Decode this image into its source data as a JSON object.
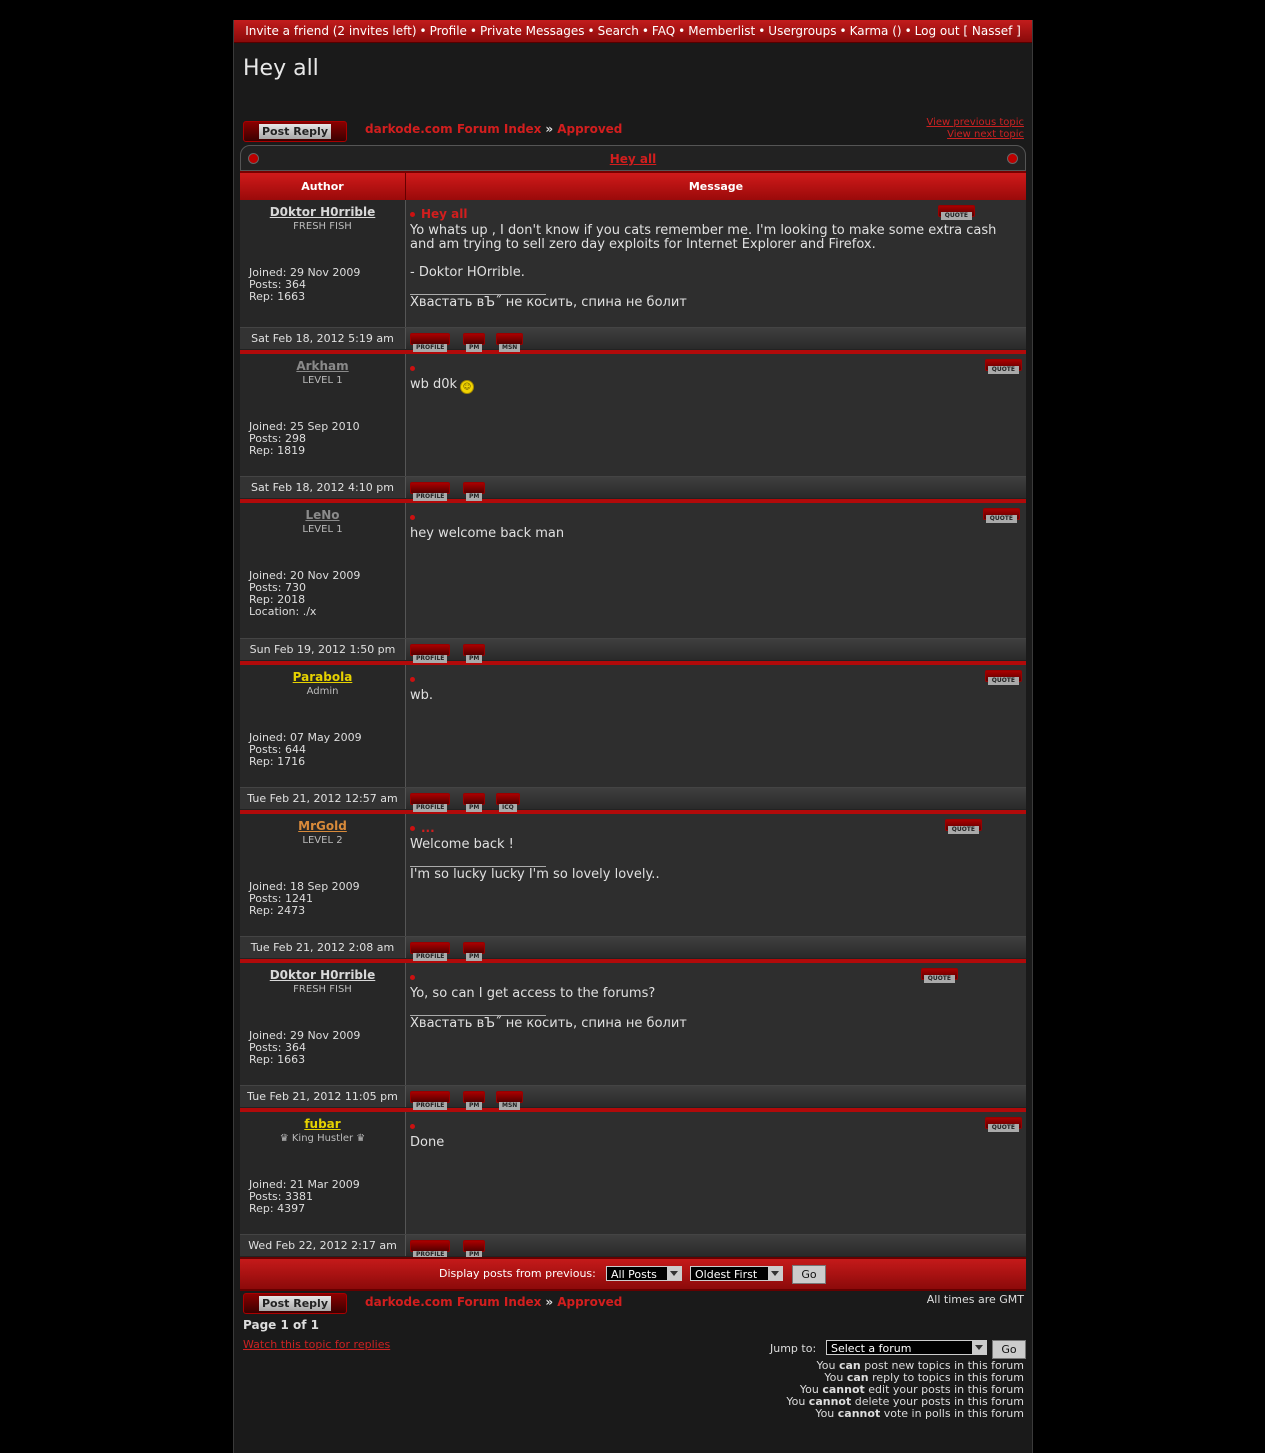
{
  "topnav": {
    "invite": "Invite a friend (2 invites left)",
    "profile": "Profile",
    "pm": "Private Messages",
    "search": "Search",
    "faq": "FAQ",
    "memberlist": "Memberlist",
    "usergroups": "Usergroups",
    "karma": "Karma ()",
    "logout": "Log out [ Nassef ]"
  },
  "topic_title": "Hey all",
  "post_reply_label": "Post Reply",
  "breadcrumb": {
    "index": "darkode.com Forum Index",
    "arrow": "»",
    "forum": "Approved"
  },
  "topic_nav": {
    "prev": "View previous topic",
    "next": "View next topic"
  },
  "table": {
    "caption": "Hey all",
    "col_author": "Author",
    "col_message": "Message"
  },
  "buttons": {
    "quote": "QUOTE",
    "profile": "PROFILE",
    "pm": "PM",
    "msn": "MSN",
    "icq": "ICQ"
  },
  "posts": [
    {
      "author": "D0ktor H0rrible",
      "author_color": "#d8d8d8",
      "rank": "FRESH FISH",
      "joined": "Joined: 29 Nov 2009",
      "posts": "Posts: 364",
      "rep": "Rep: 1663",
      "location": "",
      "subject": "Hey all",
      "body": "Yo whats up , I don't know if you cats remember me. I'm looking to make some extra cash and am trying to sell zero day exploits for Internet Explorer and Firefox.",
      "body2": "- Doktor HOrrible.",
      "sig": "Хваcтать вЪ˝ не косить, спина не болит",
      "date": "Sat Feb 18, 2012 5:19 am"
    },
    {
      "author": "Arkham",
      "author_color": "#8a8a8a",
      "rank": "LEVEL 1",
      "joined": "Joined: 25 Sep 2010",
      "posts": "Posts: 298",
      "rep": "Rep: 1819",
      "location": "",
      "subject": "",
      "body": "wb d0k",
      "body2": "",
      "sig": "",
      "date": "Sat Feb 18, 2012 4:10 pm"
    },
    {
      "author": "LeNo",
      "author_color": "#8a8a8a",
      "rank": "LEVEL 1",
      "joined": "Joined: 20 Nov 2009",
      "posts": "Posts: 730",
      "rep": "Rep: 2018",
      "location": "Location: ./x",
      "subject": "",
      "body": "hey welcome back man",
      "body2": "",
      "sig": "",
      "date": "Sun Feb 19, 2012 1:50 pm"
    },
    {
      "author": "Parabola",
      "author_color": "#e6d200",
      "rank": "Admin",
      "joined": "Joined: 07 May 2009",
      "posts": "Posts: 644",
      "rep": "Rep: 1716",
      "location": "",
      "subject": "",
      "body": "wb.",
      "body2": "",
      "sig": "",
      "date": "Tue Feb 21, 2012 12:57 am"
    },
    {
      "author": "MrGold",
      "author_color": "#d88a3a",
      "rank": "LEVEL 2",
      "joined": "Joined: 18 Sep 2009",
      "posts": "Posts: 1241",
      "rep": "Rep: 2473",
      "location": "",
      "subject": "...",
      "body": "Welcome back !",
      "body2": "",
      "sig": "I'm so lucky lucky I'm so lovely lovely..",
      "date": "Tue Feb 21, 2012 2:08 am"
    },
    {
      "author": "D0ktor H0rrible",
      "author_color": "#d8d8d8",
      "rank": "FRESH FISH",
      "joined": "Joined: 29 Nov 2009",
      "posts": "Posts: 364",
      "rep": "Rep: 1663",
      "location": "",
      "subject": "",
      "body": "Yo, so can I get access to the forums?",
      "body2": "",
      "sig": "Хваcтать вЪ˝ не косить, спина не болит",
      "date": "Tue Feb 21, 2012 11:05 pm"
    },
    {
      "author": "fubar",
      "author_color": "#e6d200",
      "rank": "♛ King Hustler ♛",
      "joined": "Joined: 21 Mar 2009",
      "posts": "Posts: 3381",
      "rep": "Rep: 4397",
      "location": "",
      "subject": "",
      "body": "Done",
      "body2": "",
      "sig": "",
      "date": "Wed Feb 22, 2012 2:17 am"
    }
  ],
  "display_bar": {
    "label": "Display posts from previous:",
    "range_value": "All Posts",
    "order_value": "Oldest First",
    "go": "Go"
  },
  "bottom": {
    "timezone": "All times are GMT",
    "page": "Page 1 of 1",
    "watch": "Watch this topic for replies",
    "jump_label": "Jump to:",
    "jump_value": "Select a forum",
    "jump_go": "Go",
    "perms": [
      [
        "You ",
        "can",
        " post new topics in this forum"
      ],
      [
        "You ",
        "can",
        " reply to topics in this forum"
      ],
      [
        "You ",
        "cannot",
        " edit your posts in this forum"
      ],
      [
        "You ",
        "cannot",
        " delete your posts in this forum"
      ],
      [
        "You ",
        "cannot",
        " vote in polls in this forum"
      ]
    ]
  }
}
